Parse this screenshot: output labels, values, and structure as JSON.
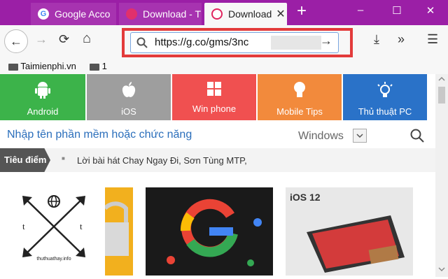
{
  "tabs": [
    {
      "label": "Google Acco",
      "close": ""
    },
    {
      "label": "Download - T",
      "close": ""
    },
    {
      "label": "Download",
      "close": "✕"
    }
  ],
  "new_tab": "+",
  "window": {
    "minimize": "–",
    "maximize": "☐",
    "close": "✕"
  },
  "nav": {
    "back": "←",
    "forward": "→",
    "reload": "⟳",
    "home": "⌂",
    "download": "⤓",
    "more": "»",
    "menu": "☰"
  },
  "url": {
    "value": "https://g.co/gms/3nc",
    "go": "→"
  },
  "bookmarks": {
    "item1": "Taimienphi.vn",
    "item2": "1"
  },
  "categories": [
    {
      "label": "Android",
      "color": "#3cb34a",
      "icon": "android-icon"
    },
    {
      "label": "iOS",
      "color": "#9e9e9e",
      "icon": "apple-icon"
    },
    {
      "label": "Win phone",
      "color": "#f05050",
      "icon": "windows-icon"
    },
    {
      "label": "Mobile Tips",
      "color": "#f28a3c",
      "icon": "bulb-icon"
    },
    {
      "label": "Thủ thuật PC",
      "color": "#2a72c8",
      "icon": "lightbulb-icon"
    }
  ],
  "search": {
    "placeholder": "Nhập tên phần mềm hoặc chức năng",
    "platform": "Windows"
  },
  "ticker": {
    "label": "Tiêu điểm",
    "bullet": "■",
    "headline": "Lời bài hát Chay Ngay Đi, Sơn Tùng MTP,"
  },
  "thumbs": {
    "ios_text": "iOS 12"
  },
  "watermark": {
    "t_left": "t",
    "t_right": "t",
    "site": "thuthuathay.info"
  }
}
